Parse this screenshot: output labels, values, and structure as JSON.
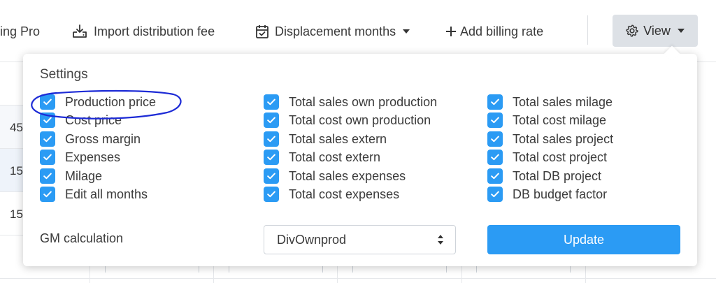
{
  "toolbar": {
    "truncated_item": "ing Pro",
    "import_label": "Import distribution fee",
    "displacement_label": "Displacement months",
    "add_billing_label": "Add billing rate",
    "view_label": "View"
  },
  "background": {
    "row_values": [
      "45",
      "15",
      "15"
    ]
  },
  "settings": {
    "title": "Settings",
    "columns": [
      [
        {
          "label": "Production price",
          "checked": true
        },
        {
          "label": "Cost price",
          "checked": true
        },
        {
          "label": "Gross margin",
          "checked": true
        },
        {
          "label": "Expenses",
          "checked": true
        },
        {
          "label": "Milage",
          "checked": true
        },
        {
          "label": "Edit all months",
          "checked": true
        }
      ],
      [
        {
          "label": "Total sales own production",
          "checked": true
        },
        {
          "label": "Total cost own production",
          "checked": true
        },
        {
          "label": "Total sales extern",
          "checked": true
        },
        {
          "label": "Total cost extern",
          "checked": true
        },
        {
          "label": "Total sales expenses",
          "checked": true
        },
        {
          "label": "Total cost expenses",
          "checked": true
        }
      ],
      [
        {
          "label": "Total sales milage",
          "checked": true
        },
        {
          "label": "Total cost milage",
          "checked": true
        },
        {
          "label": "Total sales project",
          "checked": true
        },
        {
          "label": "Total cost project",
          "checked": true
        },
        {
          "label": "Total DB project",
          "checked": true
        },
        {
          "label": "DB budget factor",
          "checked": true
        }
      ]
    ],
    "gm_label": "GM calculation",
    "gm_value": "DivOwnprod",
    "update_label": "Update"
  },
  "colors": {
    "accent": "#2b9bf4",
    "view_button_bg": "#dde1e6",
    "annotation": "#1d2bd6"
  }
}
